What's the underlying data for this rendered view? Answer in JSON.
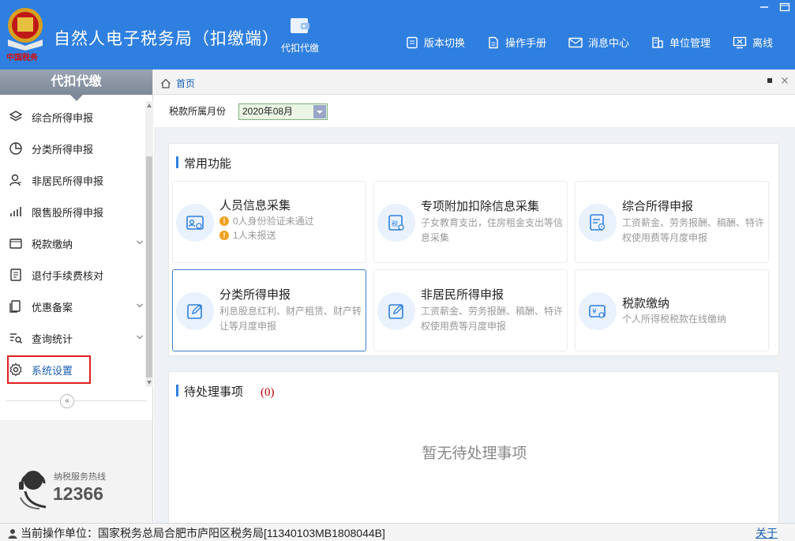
{
  "header": {
    "app_title": "自然人电子税务局（扣缴端）",
    "main_nav_label": "代扣代缴",
    "toolbar": [
      {
        "label": "版本切换",
        "icon": "version-switch-icon"
      },
      {
        "label": "操作手册",
        "icon": "manual-icon"
      },
      {
        "label": "消息中心",
        "icon": "message-icon"
      },
      {
        "label": "单位管理",
        "icon": "building-icon"
      },
      {
        "label": "离线",
        "icon": "offline-icon"
      }
    ]
  },
  "sidebar": {
    "title": "代扣代缴",
    "items": [
      {
        "label": "综合所得申报",
        "icon": "layers-icon",
        "expandable": false
      },
      {
        "label": "分类所得申报",
        "icon": "pie-chart-icon",
        "expandable": false
      },
      {
        "label": "非居民所得申报",
        "icon": "person-icon",
        "expandable": false
      },
      {
        "label": "限售股所得申报",
        "icon": "bar-chart-icon",
        "expandable": false
      },
      {
        "label": "税款缴纳",
        "icon": "wallet-icon",
        "expandable": true
      },
      {
        "label": "退付手续费核对",
        "icon": "checklist-icon",
        "expandable": false
      },
      {
        "label": "优惠备案",
        "icon": "document-icon",
        "expandable": true
      },
      {
        "label": "查询统计",
        "icon": "search-list-icon",
        "expandable": true
      },
      {
        "label": "系统设置",
        "icon": "gear-icon",
        "expandable": false
      }
    ],
    "collapse_symbol": "«",
    "hotline": {
      "label": "纳税服务热线",
      "number": "12366"
    }
  },
  "tabs": {
    "home_label": "首页"
  },
  "filter": {
    "label": "税款所属月份",
    "value": "2020年08月"
  },
  "common_functions": {
    "title": "常用功能",
    "cards": [
      {
        "title": "人员信息采集",
        "warnings": [
          "0人身份验证未通过",
          "1人未报送"
        ]
      },
      {
        "title": "专项附加扣除信息采集",
        "desc": "子女教育支出，住房租金支出等信息采集",
        "badge": "税"
      },
      {
        "title": "综合所得申报",
        "desc": "工资薪金、劳务报酬、稿酬、特许权使用费等月度申报"
      },
      {
        "title": "分类所得申报",
        "desc": "利息股息红利、财产租赁、财产转让等月度申报"
      },
      {
        "title": "非居民所得申报",
        "desc": "工资薪金、劳务报酬、稿酬、特许权使用费等月度申报"
      },
      {
        "title": "税款缴纳",
        "desc": "个人所得税税款在线缴纳",
        "badge": "¥"
      }
    ]
  },
  "pending": {
    "title": "待处理事项",
    "count": "(0)",
    "empty_text": "暂无待处理事项"
  },
  "status_bar": {
    "text": "当前操作单位：国家税务总局合肥市庐阳区税务局[11340103MB1808044B]",
    "about": "关于"
  },
  "colors": {
    "header": "#2f7fe0",
    "accent": "#1a5fb4",
    "highlight": "#e02020"
  }
}
